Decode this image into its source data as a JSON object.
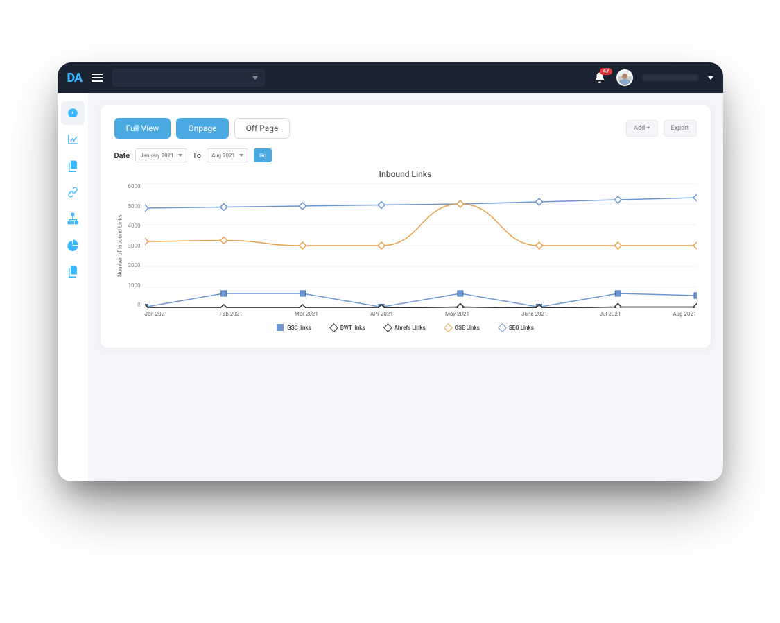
{
  "brand": {
    "logo_text": "DA"
  },
  "header": {
    "notification_count": "47"
  },
  "card": {
    "tabs": {
      "full_view": "Full View",
      "onpage": "Onpage",
      "offpage": "Off Page"
    },
    "actions": {
      "add": "Add +",
      "export": "Export"
    },
    "date": {
      "label": "Date",
      "from": "January 2021",
      "to_label": "To",
      "to": "Aug  2021",
      "go": "Go"
    }
  },
  "chart_data": {
    "type": "line",
    "title": "Inbound Links",
    "xlabel": "",
    "ylabel": "Number of Inbound Links",
    "ylim": [
      0,
      6000
    ],
    "yticks": [
      6000,
      5000,
      4000,
      3000,
      2000,
      1000,
      0
    ],
    "categories": [
      "Jan 2021",
      "Feb 2021",
      "Mar 2021",
      "APr 2021",
      "May 2021",
      "June 2021",
      "Jul 2021",
      "Aug 2021"
    ],
    "series": [
      {
        "name": "GSC links",
        "color": "#6d97d1",
        "marker": "square",
        "values": [
          50,
          700,
          700,
          50,
          700,
          50,
          700,
          600
        ]
      },
      {
        "name": "BWT links",
        "color": "#333333",
        "marker": "diamond",
        "values": [
          0,
          0,
          0,
          0,
          50,
          0,
          50,
          50
        ]
      },
      {
        "name": "Ahrefs Links",
        "color": "#333333",
        "marker": "diamond",
        "values": [
          0,
          0,
          0,
          0,
          50,
          0,
          50,
          50
        ]
      },
      {
        "name": "OSE Links",
        "color": "#e8a14a",
        "marker": "diamond",
        "values": [
          3200,
          3250,
          3000,
          3000,
          5000,
          3000,
          3000,
          3000
        ]
      },
      {
        "name": "SEO Links",
        "color": "#6d97d1",
        "marker": "diamond",
        "values": [
          4800,
          4850,
          4900,
          4950,
          5000,
          5100,
          5200,
          5300
        ]
      }
    ]
  }
}
